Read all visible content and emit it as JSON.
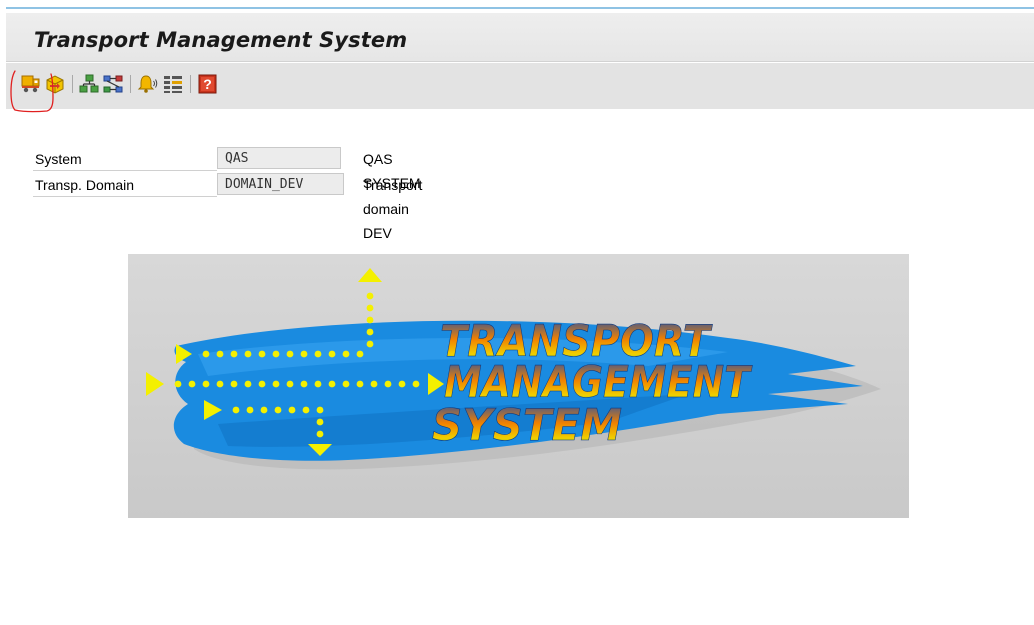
{
  "header": {
    "title": "Transport Management System"
  },
  "toolbar": {
    "buttons": [
      {
        "icon": "truck-icon",
        "name": "transport-routes-button"
      },
      {
        "icon": "import-overview-icon",
        "name": "import-overview-button"
      },
      {
        "icon": "system-overview-icon",
        "name": "system-overview-button"
      },
      {
        "icon": "transport-route-icon",
        "name": "transport-routes-editor-button"
      },
      {
        "icon": "alert-monitor-icon",
        "name": "alert-monitor-button"
      },
      {
        "icon": "tms-log-icon",
        "name": "tms-log-button"
      },
      {
        "icon": "help-icon",
        "name": "help-button"
      }
    ]
  },
  "form": {
    "system": {
      "label": "System",
      "value": "QAS",
      "description": "QAS SYSTEM"
    },
    "domain": {
      "label": "Transp. Domain",
      "value": "DOMAIN_DEV",
      "description": "Transport domain DEV"
    }
  },
  "logo": {
    "line1": "TRANSPORT",
    "line2": "MANAGEMENT",
    "line3": "SYSTEM"
  },
  "colors": {
    "accent_line": "#8fc3e4",
    "logo_blue": "#1a8be0",
    "arrow_yellow": "#f4f000",
    "annotation_red": "#e02020"
  }
}
